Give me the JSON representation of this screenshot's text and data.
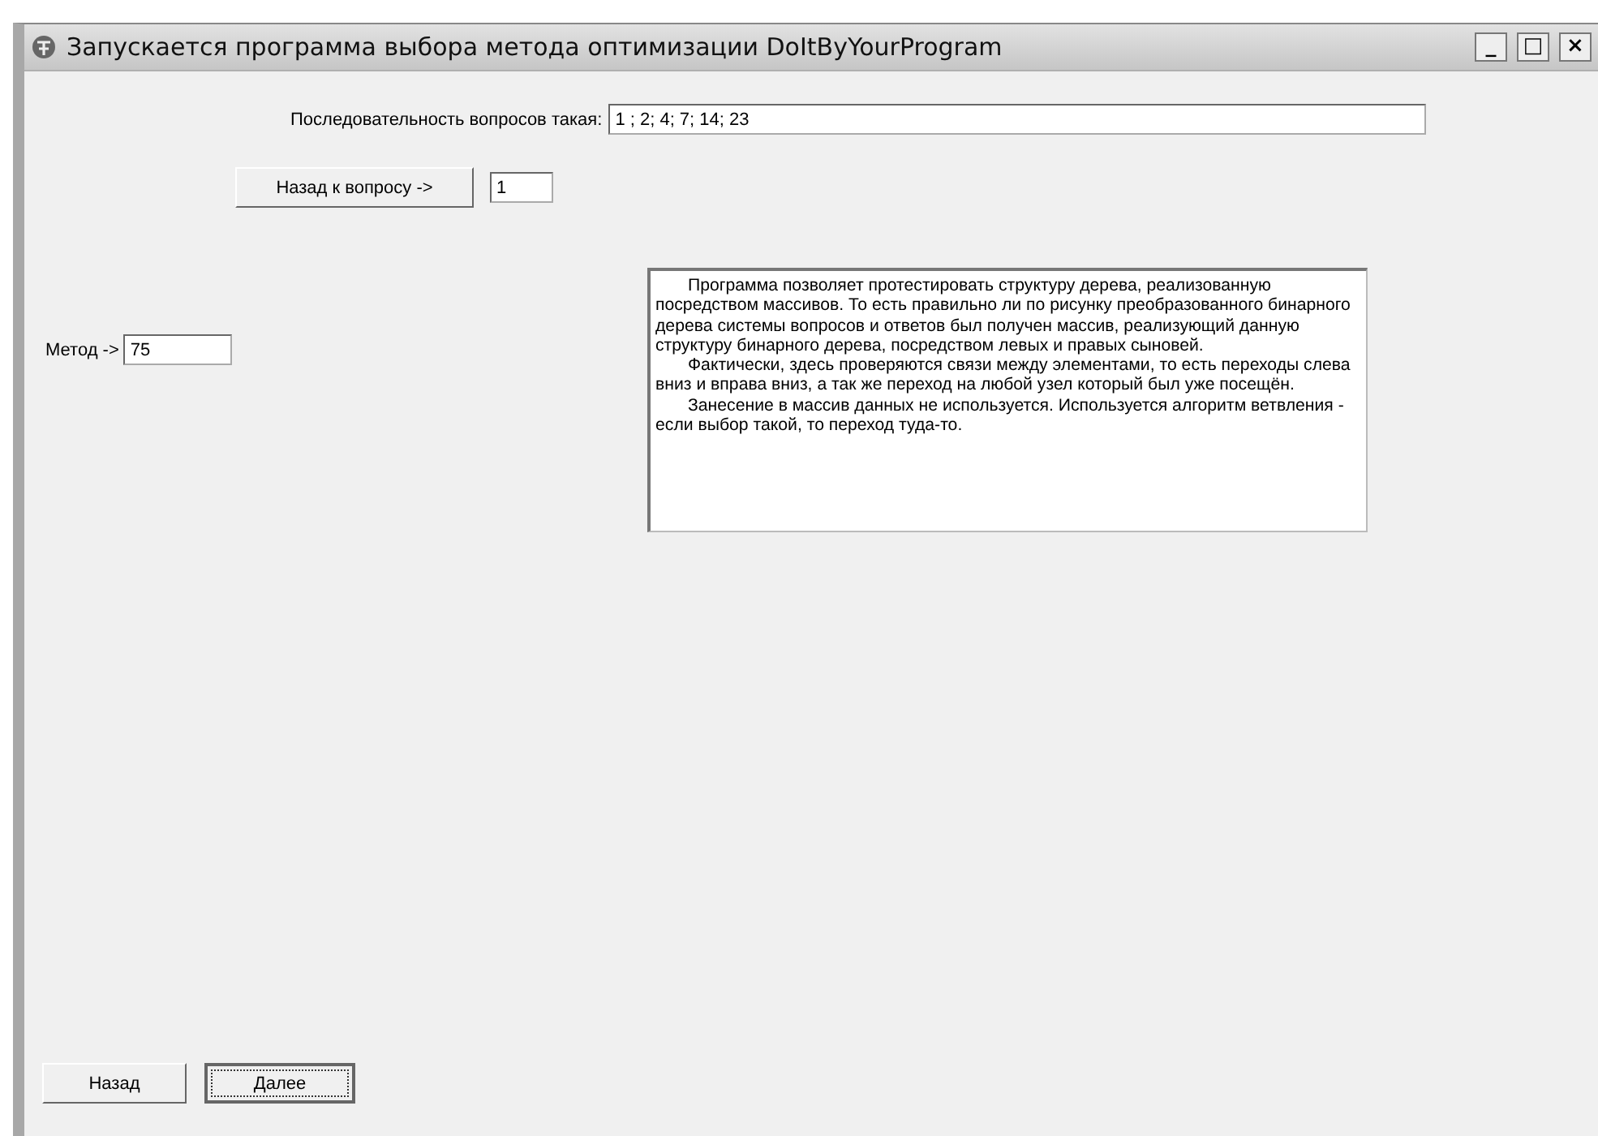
{
  "window": {
    "title": "Запускается программа выбора метода оптимизации DoItByYourProgram",
    "controls": [
      "_",
      "□",
      "×"
    ]
  },
  "sequence": {
    "label": "Последовательность вопросов такая:",
    "value": "1 ; 2; 4; 7; 14; 23"
  },
  "back_to_question": {
    "button": "Назад к вопросу ->",
    "value": "1"
  },
  "method": {
    "label": "Метод ->",
    "value": "75"
  },
  "description": [
    "Программа позволяет протестировать структуру дерева, реализованную посредством массивов. То есть правильно ли по рисунку преобразованного бинарного дерева системы вопросов и ответов был получен массив, реализующий данную структуру бинарного дерева, посредством левых и правых сыновей.",
    "Фактически, здесь проверяются связи между элементами, то есть переходы слева вниз и вправа вниз, а так же переход на любой узел который был уже посещён.",
    "Занесение в массив данных не используется. Используется алгоритм ветвления - если выбор такой, то переход туда-то."
  ],
  "buttons": [
    {
      "label": "Назад",
      "default": false
    },
    {
      "label": "Далее",
      "default": true
    }
  ]
}
